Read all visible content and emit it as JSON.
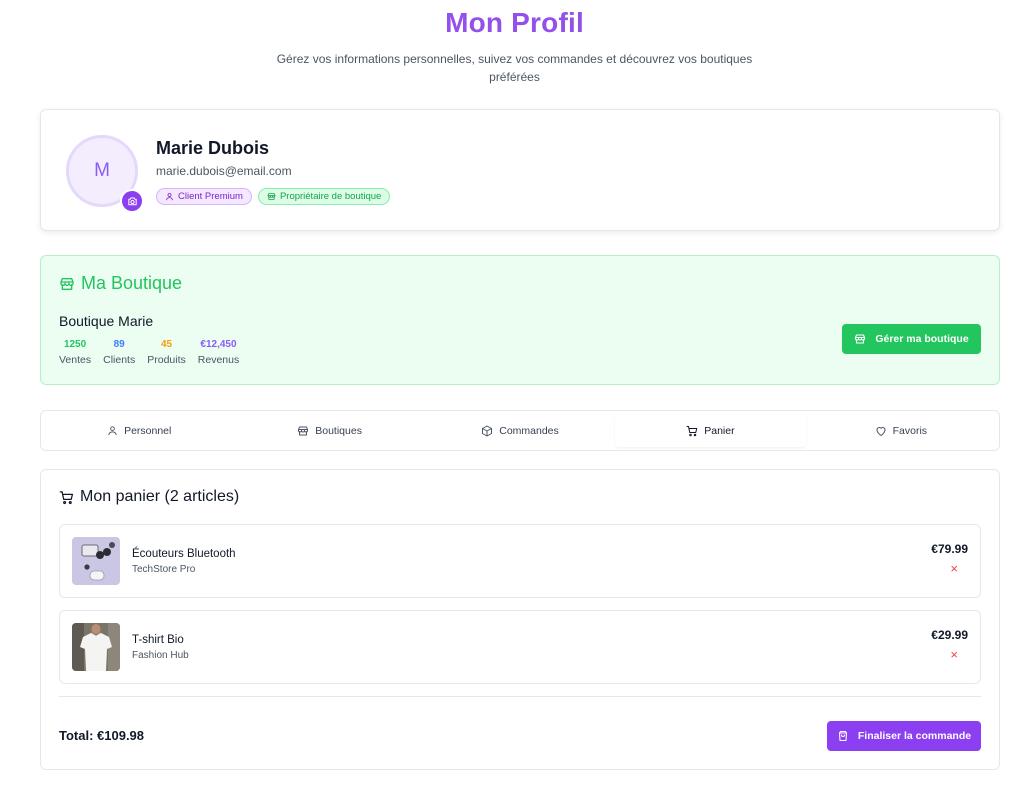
{
  "header": {
    "title": "Mon Profil",
    "subtitle": "Gérez vos informations personnelles, suivez vos commandes et découvrez vos boutiques préférées"
  },
  "profile": {
    "avatar_initial": "M",
    "name": "Marie Dubois",
    "email": "marie.dubois@email.com",
    "badges": [
      {
        "label": "Client Premium",
        "icon": "user-icon"
      },
      {
        "label": "Propriétaire de boutique",
        "icon": "store-icon"
      }
    ],
    "avatar_button_icon": "camera-icon"
  },
  "shop": {
    "heading": "Ma Boutique",
    "name": "Boutique Marie",
    "stats": [
      {
        "value": "1250",
        "label": "Ventes",
        "color": "#22c55e"
      },
      {
        "value": "89",
        "label": "Clients",
        "color": "#3b82f6"
      },
      {
        "value": "45",
        "label": "Produits",
        "color": "#f59e0b"
      },
      {
        "value": "€12,450",
        "label": "Revenus",
        "color": "#8b5cf6"
      }
    ],
    "manage_label": "Gérer ma boutique"
  },
  "tabs": [
    {
      "label": "Personnel",
      "icon": "user-icon",
      "active": false
    },
    {
      "label": "Boutiques",
      "icon": "store-icon",
      "active": false
    },
    {
      "label": "Commandes",
      "icon": "package-icon",
      "active": false
    },
    {
      "label": "Panier",
      "icon": "cart-icon",
      "active": true
    },
    {
      "label": "Favoris",
      "icon": "heart-icon",
      "active": false
    }
  ],
  "cart": {
    "heading": "Mon panier (2 articles)",
    "items": [
      {
        "name": "Écouteurs Bluetooth",
        "shop": "TechStore Pro",
        "price": "€79.99",
        "remove": "×"
      },
      {
        "name": "T-shirt Bio",
        "shop": "Fashion Hub",
        "price": "€29.99",
        "remove": "×"
      }
    ],
    "total": "Total: €109.98",
    "checkout_label": "Finaliser la commande"
  },
  "colors": {
    "accent_purple": "#9350ea",
    "accent_green": "#22c55e",
    "danger": "#ef4444"
  }
}
